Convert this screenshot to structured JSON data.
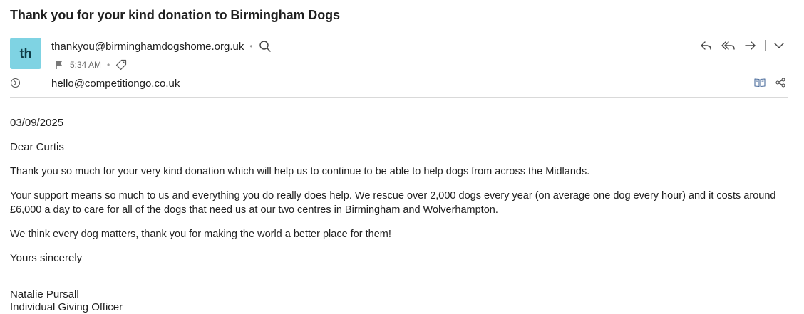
{
  "email": {
    "subject": "Thank you for your kind donation to Birmingham Dogs",
    "avatar_initials": "th",
    "avatar_color": "#7fd3e3",
    "from": "thankyou@birminghamdogshome.org.uk",
    "time": "5:34 AM",
    "to": "hello@competitiongo.co.uk"
  },
  "icons": {
    "search": "search-icon",
    "flag": "flag-icon",
    "tag": "tag-icon",
    "reply": "reply-icon",
    "reply_all": "reply-all-icon",
    "forward": "forward-icon",
    "more": "chevron-down-icon",
    "expand": "chevron-right-circle-icon",
    "reader": "book-icon",
    "share": "share-icon"
  },
  "body": {
    "date": "03/09/2025",
    "greeting": "Dear Curtis",
    "paragraph1": "Thank you so much for your very kind donation which will help us to continue to be able to help dogs from across the Midlands.",
    "paragraph2": "Your support means so much to us and everything you do really does help.  We rescue over 2,000 dogs every year (on average one dog every hour) and it costs around £6,000 a day to care for all of the dogs that need us at our two centres in Birmingham and Wolverhampton.",
    "paragraph3": "We think every dog matters, thank you for making the world a better place for them!",
    "closing": "Yours sincerely",
    "signature_name": "Natalie Pursall",
    "signature_title": "Individual Giving Officer"
  }
}
